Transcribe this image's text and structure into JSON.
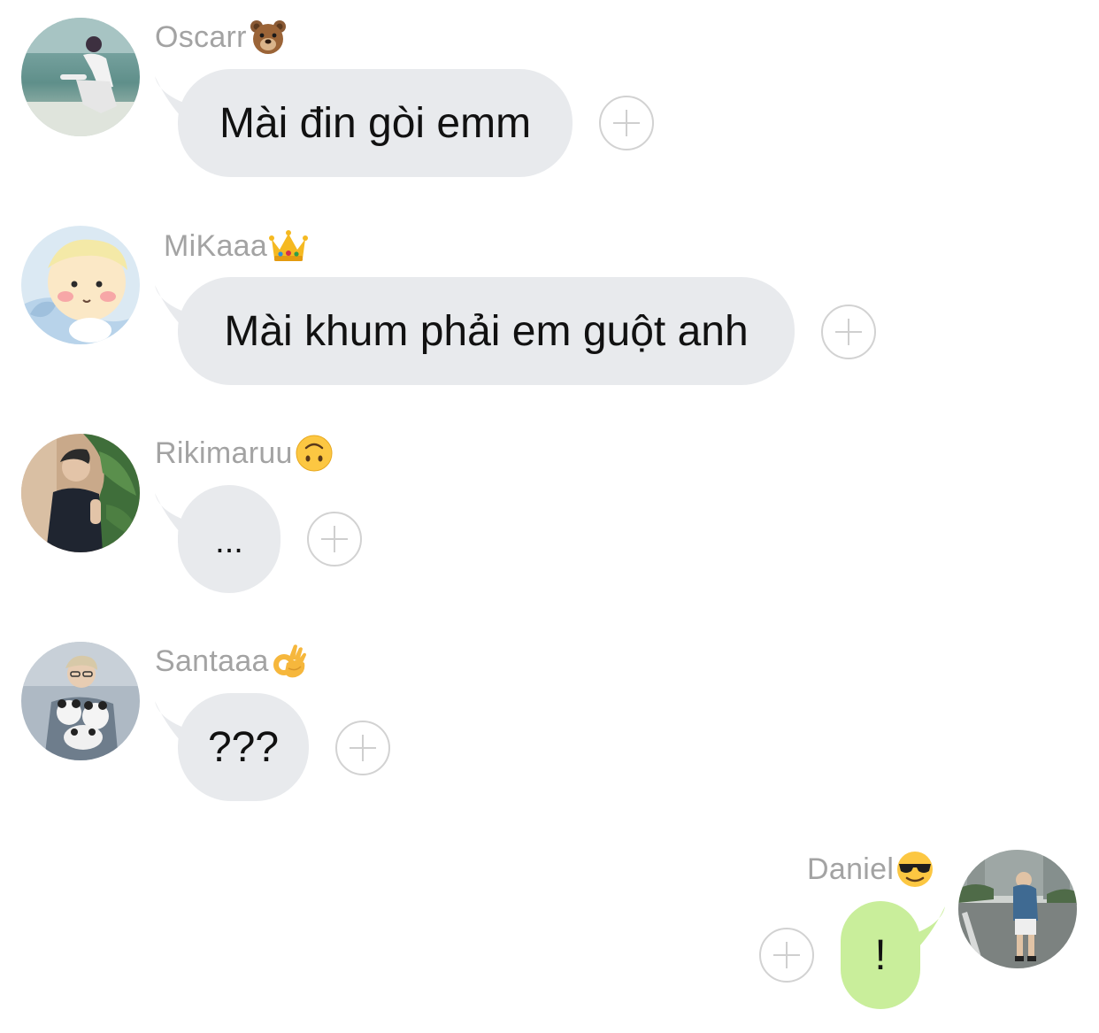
{
  "colors": {
    "incoming_bubble": "#e8eaed",
    "outgoing_bubble": "#c9ee9b",
    "sender_name": "#a3a3a3",
    "reaction_outline": "#d2d2d2"
  },
  "messages": [
    {
      "sender": "Oscarr",
      "sender_emoji": "bear-face-emoji",
      "text": "Mài đin gòi emm",
      "direction": "incoming",
      "reaction_button": "add-reaction-icon"
    },
    {
      "sender": "MiKaaa",
      "sender_emoji": "crown-emoji",
      "text": "Mài khum phải em guột anh",
      "direction": "incoming",
      "reaction_button": "add-reaction-icon"
    },
    {
      "sender": "Rikimaruu",
      "sender_emoji": "upside-down-face-emoji",
      "text": "...",
      "direction": "incoming",
      "reaction_button": "add-reaction-icon"
    },
    {
      "sender": "Santaaa",
      "sender_emoji": "ok-hand-emoji",
      "text": "???",
      "direction": "incoming",
      "reaction_button": "add-reaction-icon"
    },
    {
      "sender": "Daniel",
      "sender_emoji": "sunglasses-face-emoji",
      "text": "!",
      "direction": "outgoing",
      "reaction_button": "add-reaction-icon"
    }
  ]
}
